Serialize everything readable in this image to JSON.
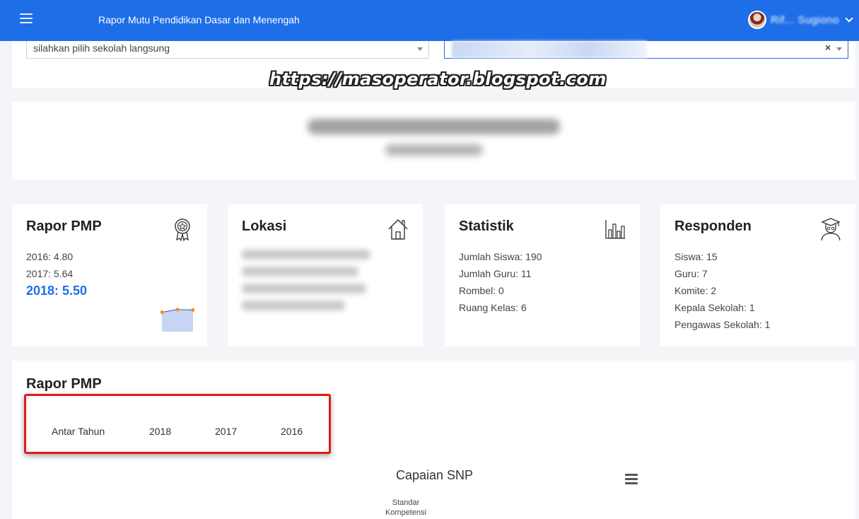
{
  "header": {
    "menu_icon": "hamburger-icon",
    "title": "Rapor Mutu Pendidikan Dasar dan Menengah",
    "user_name": "Rif... Sugiono",
    "user_chevron": "chevron-down-icon"
  },
  "filters": {
    "school_select_value": "silahkan pilih sekolah langsung",
    "region_select_clear": "×"
  },
  "watermark": "https://masoperator.blogspot.com",
  "cards": {
    "rapor": {
      "title": "Rapor PMP",
      "icon": "award-icon",
      "lines": [
        "2016: 4.80",
        "2017: 5.64"
      ],
      "highlight": "2018: 5.50",
      "trend": [
        4.8,
        5.64,
        5.5
      ]
    },
    "lokasi": {
      "title": "Lokasi",
      "icon": "home-icon"
    },
    "statistik": {
      "title": "Statistik",
      "icon": "bar-chart-icon",
      "lines": [
        "Jumlah Siswa: 190",
        "Jumlah Guru: 11",
        "Rombel: 0",
        "Ruang Kelas: 6"
      ]
    },
    "responden": {
      "title": "Responden",
      "icon": "graduate-icon",
      "lines": [
        "Siswa: 15",
        "Guru: 7",
        "Komite: 2",
        "Kepala Sekolah: 1",
        "Pengawas Sekolah: 1"
      ]
    }
  },
  "rapor_section": {
    "title": "Rapor PMP",
    "tabs": [
      "Antar Tahun",
      "2018",
      "2017",
      "2016"
    ],
    "chart_title": "Capaian SNP",
    "chart_menu_icon": "menu-icon",
    "axis_label_line1": "Standar",
    "axis_label_line2": "Kompetensi"
  },
  "colors": {
    "primary": "#1e6ee8",
    "tab_box_border": "#e01b1b",
    "spark_fill": "#c6d5f3",
    "spark_point": "#f28a2a"
  }
}
